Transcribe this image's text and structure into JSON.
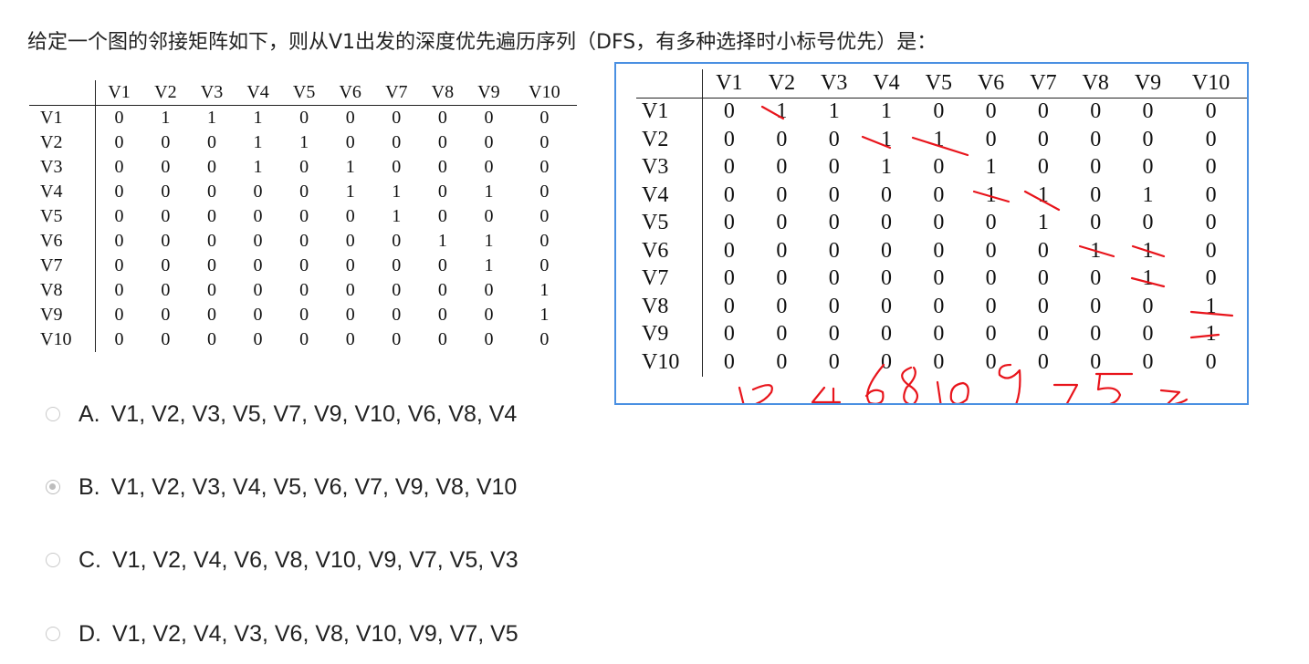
{
  "question": "给定一个图的邻接矩阵如下，则从V1出发的深度优先遍历序列（DFS，有多种选择时小标号优先）是：",
  "matrix": {
    "headers": [
      "V1",
      "V2",
      "V3",
      "V4",
      "V5",
      "V6",
      "V7",
      "V8",
      "V9",
      "V10"
    ],
    "rows": [
      {
        "label": "V1",
        "values": [
          "0",
          "1",
          "1",
          "1",
          "0",
          "0",
          "0",
          "0",
          "0",
          "0"
        ]
      },
      {
        "label": "V2",
        "values": [
          "0",
          "0",
          "0",
          "1",
          "1",
          "0",
          "0",
          "0",
          "0",
          "0"
        ]
      },
      {
        "label": "V3",
        "values": [
          "0",
          "0",
          "0",
          "1",
          "0",
          "1",
          "0",
          "0",
          "0",
          "0"
        ]
      },
      {
        "label": "V4",
        "values": [
          "0",
          "0",
          "0",
          "0",
          "0",
          "1",
          "1",
          "0",
          "1",
          "0"
        ]
      },
      {
        "label": "V5",
        "values": [
          "0",
          "0",
          "0",
          "0",
          "0",
          "0",
          "1",
          "0",
          "0",
          "0"
        ]
      },
      {
        "label": "V6",
        "values": [
          "0",
          "0",
          "0",
          "0",
          "0",
          "0",
          "0",
          "1",
          "1",
          "0"
        ]
      },
      {
        "label": "V7",
        "values": [
          "0",
          "0",
          "0",
          "0",
          "0",
          "0",
          "0",
          "0",
          "1",
          "0"
        ]
      },
      {
        "label": "V8",
        "values": [
          "0",
          "0",
          "0",
          "0",
          "0",
          "0",
          "0",
          "0",
          "0",
          "1"
        ]
      },
      {
        "label": "V9",
        "values": [
          "0",
          "0",
          "0",
          "0",
          "0",
          "0",
          "0",
          "0",
          "0",
          "1"
        ]
      },
      {
        "label": "V10",
        "values": [
          "0",
          "0",
          "0",
          "0",
          "0",
          "0",
          "0",
          "0",
          "0",
          "0"
        ]
      }
    ]
  },
  "annotation": {
    "handwriting": "12468109753",
    "ink_color": "#e8141b",
    "frame_color": "#4a90e2"
  },
  "options": [
    {
      "letter": "A.",
      "text": "V1, V2, V3, V5, V7, V9, V10, V6, V8, V4",
      "selected": false
    },
    {
      "letter": "B.",
      "text": "V1, V2, V3, V4, V5, V6, V7, V9, V8, V10",
      "selected": true
    },
    {
      "letter": "C.",
      "text": "V1, V2, V4, V6, V8, V10, V9, V7, V5, V3",
      "selected": false
    },
    {
      "letter": "D.",
      "text": "V1, V2, V4, V3, V6, V8, V10, V9, V7, V5",
      "selected": false
    }
  ]
}
